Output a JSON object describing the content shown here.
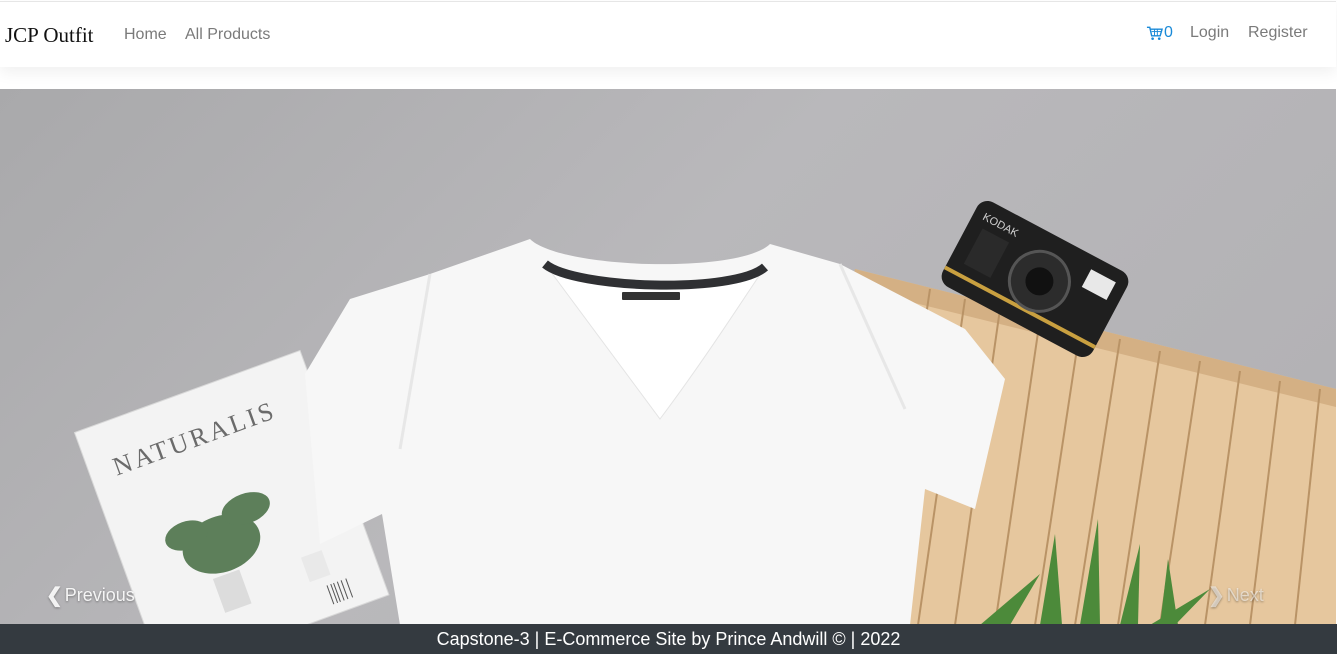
{
  "navbar": {
    "brand": "JCP Outfit",
    "links": [
      "Home",
      "All Products"
    ],
    "cart_count": "0",
    "login": "Login",
    "register": "Register",
    "cart_icon": "shopping-cart-icon",
    "accent_color": "#1a8ad8"
  },
  "carousel": {
    "previous_label": "Previous",
    "next_label": "Next",
    "previous_icon": "chevron-left-icon",
    "next_icon": "chevron-right-icon",
    "magazine_title": "NATURALIS",
    "camera_brand": "KODAK"
  },
  "footer": {
    "text": "Capstone-3 | E-Commerce Site by Prince Andwill © | 2022",
    "background": "#343a40"
  }
}
